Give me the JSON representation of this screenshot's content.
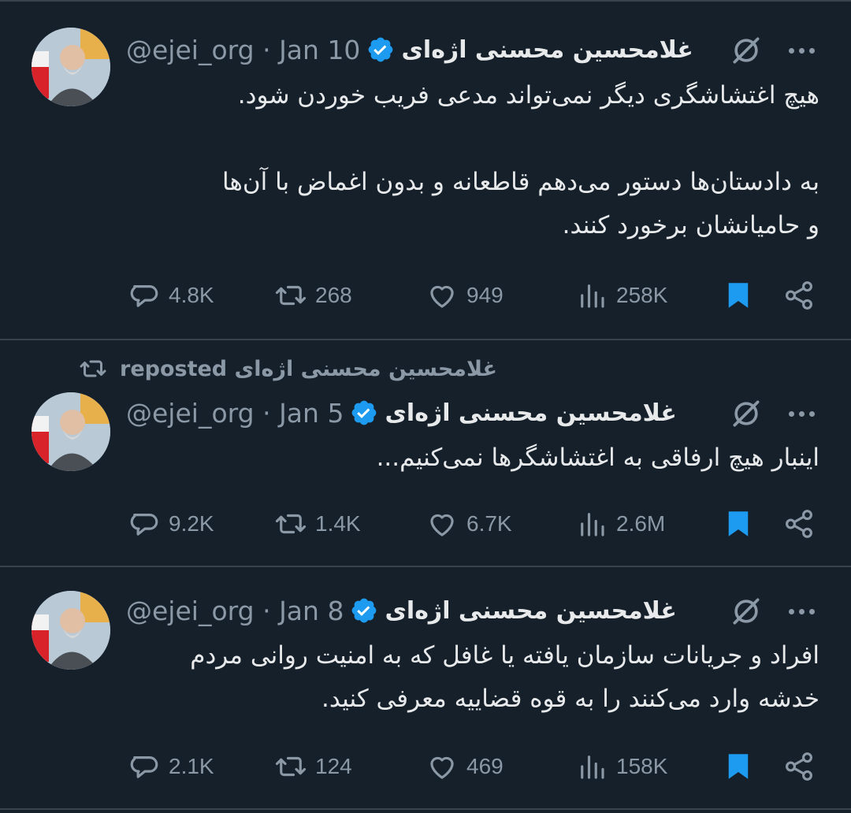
{
  "colors": {
    "background": "#15202b",
    "text": "#e7e9ea",
    "muted": "#8b98a5",
    "verified": "#1d9bf0",
    "bookmark": "#1d9bf0",
    "divider": "#38444d"
  },
  "tweets": [
    {
      "name": "غلامحسین محسنی اژه‌ای",
      "handle": "@ejei_org",
      "sep": "·",
      "date": "Jan 10",
      "lines": [
        "هیچ اغتشاشگری دیگر نمی‌تواند مدعی فریب خوردن شود.",
        "",
        "به دادستان‌ها دستور می‌دهم قاطعانه و بدون اغماض با آن‌ها",
        "و حامیانشان برخورد کنند."
      ],
      "replies": "4.8K",
      "reposts": "268",
      "likes": "949",
      "views": "258K"
    },
    {
      "repost_label": "غلامحسین محسنی اژه‌ای reposted",
      "name": "غلامحسین محسنی اژه‌ای",
      "handle": "@ejei_org",
      "sep": "·",
      "date": "Jan 5",
      "lines": [
        "اینبار هیچ ارفاقی به اغتشاشگرها نمی‌کنیم..."
      ],
      "replies": "9.2K",
      "reposts": "1.4K",
      "likes": "6.7K",
      "views": "2.6M"
    },
    {
      "name": "غلامحسین محسنی اژه‌ای",
      "handle": "@ejei_org",
      "sep": "·",
      "date": "Jan 8",
      "lines": [
        "افراد و جریانات سازمان یافته یا غافل که به امنیت روانی مردم",
        "خدشه وارد می‌کنند را به قوه قضاییه معرفی کنید."
      ],
      "replies": "2.1K",
      "reposts": "124",
      "likes": "469",
      "views": "158K"
    }
  ],
  "icons": {
    "reply": "comment-bubble-icon",
    "repost": "repost-arrows-icon",
    "like": "heart-icon",
    "views": "bar-chart-icon",
    "bookmark": "bookmark-filled-icon",
    "share": "share-icon",
    "grok": "grok-slash-icon",
    "more": "more-dots-icon",
    "verified": "verified-badge-icon"
  }
}
